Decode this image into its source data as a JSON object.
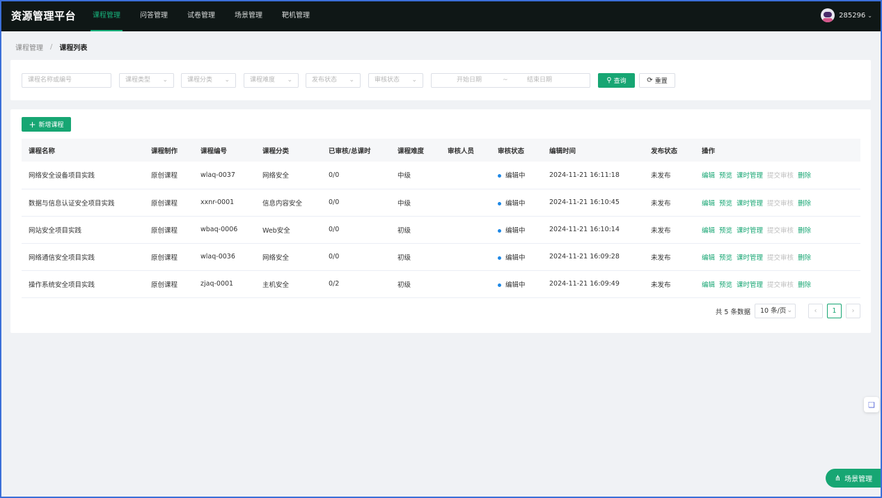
{
  "app": {
    "title": "资源管理平台",
    "username": "285296"
  },
  "nav": [
    "课程管理",
    "问答管理",
    "试卷管理",
    "场景管理",
    "靶机管理"
  ],
  "breadcrumb": {
    "parent": "课程管理",
    "current": "课程列表"
  },
  "filters": {
    "search_placeholder": "课程名称或编号",
    "type": "课程类型",
    "category": "课程分类",
    "difficulty": "课程难度",
    "publish_status": "发布状态",
    "review_status": "审核状态",
    "start_date": "开始日期",
    "date_sep": "~",
    "end_date": "结束日期",
    "query_label": "查询",
    "reset_label": "重置"
  },
  "table": {
    "add_label": "新增课程",
    "columns": [
      "课程名称",
      "课程制作",
      "课程编号",
      "课程分类",
      "已审核/总课时",
      "课程难度",
      "审核人员",
      "审核状态",
      "编辑时间",
      "发布状态",
      "操作"
    ],
    "rows": [
      [
        "网络安全设备项目实践",
        "原创课程",
        "wlaq-0037",
        "网络安全",
        "0/0",
        "中级",
        "",
        "编辑中",
        "2024-11-21 16:11:18",
        "未发布"
      ],
      [
        "数据与信息认证安全项目实践",
        "原创课程",
        "xxnr-0001",
        "信息内容安全",
        "0/0",
        "中级",
        "",
        "编辑中",
        "2024-11-21 16:10:45",
        "未发布"
      ],
      [
        "网站安全项目实践",
        "原创课程",
        "wbaq-0006",
        "Web安全",
        "0/0",
        "初级",
        "",
        "编辑中",
        "2024-11-21 16:10:14",
        "未发布"
      ],
      [
        "网络通信安全项目实践",
        "原创课程",
        "wlaq-0036",
        "网络安全",
        "0/0",
        "初级",
        "",
        "编辑中",
        "2024-11-21 16:09:28",
        "未发布"
      ],
      [
        "操作系统安全项目实践",
        "原创课程",
        "zjaq-0001",
        "主机安全",
        "0/2",
        "初级",
        "",
        "编辑中",
        "2024-11-21 16:09:49",
        "未发布"
      ]
    ],
    "actions": [
      "编辑",
      "预览",
      "课时管理",
      "提交审核",
      "删除"
    ]
  },
  "pagination": {
    "total": "共 5 条数据",
    "page_size": "10 条/页",
    "current": "1"
  },
  "float_button": "场景管理",
  "colors": {
    "accent": "#17a673",
    "topbar": "#0f1716",
    "status_dot": "#1e88e5"
  }
}
